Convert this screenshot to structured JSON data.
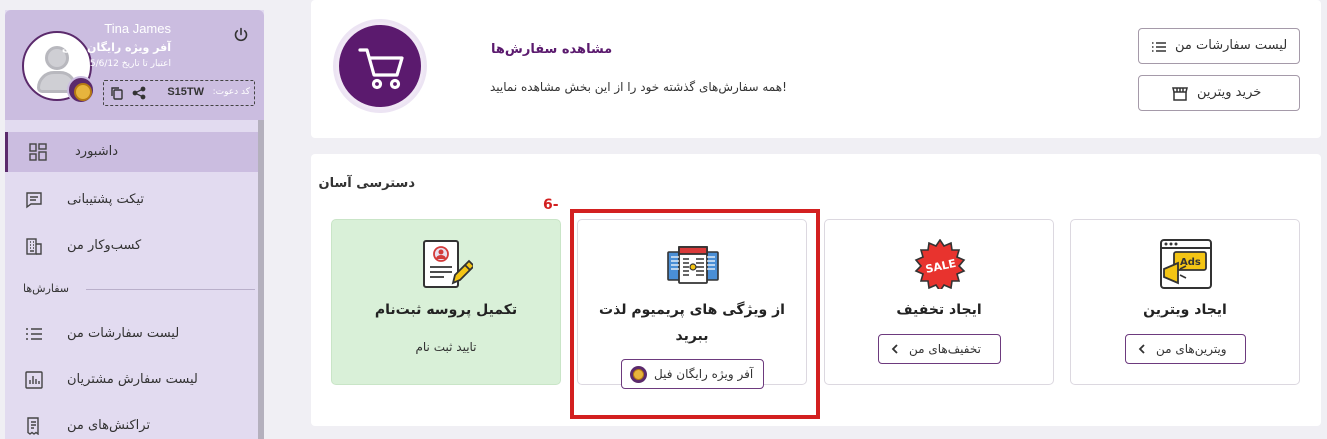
{
  "profile": {
    "name": "Tina James",
    "plan": "آفر ویژه رایگان فیل",
    "expiry": "اعتبار تا تاریخ 2025/6/12",
    "invite_label": ":کد دعوت",
    "invite_code": "S15TW"
  },
  "sidebar": {
    "items": [
      {
        "label": "داشبورد",
        "icon": "dashboard-icon",
        "active": true
      },
      {
        "label": "تیکت پشتیبانی",
        "icon": "ticket-icon"
      },
      {
        "label": "کسب‌وکار من",
        "icon": "business-icon"
      }
    ],
    "section_label": "سفارش‌ها",
    "section_items": [
      {
        "label": "لیست سفارشات من",
        "icon": "list-icon"
      },
      {
        "label": "لیست سفارش مشتریان",
        "icon": "chart-icon"
      },
      {
        "label": "تراکنش‌های من",
        "icon": "receipt-icon"
      }
    ]
  },
  "orders_card": {
    "title": "مشاهده سفارش‌ها",
    "subtitle": "همه سفارش‌های گذشته خود را از این بخش مشاهده نمایید!",
    "btn_list": "لیست سفارشات من",
    "btn_buy": "خرید ویترین"
  },
  "easy_access": {
    "title": "دسترسی آسان",
    "step_label": "6-",
    "tiles": [
      {
        "title": "ایجاد ویترین",
        "button": "ویترین‌های من",
        "icon": "ads-icon"
      },
      {
        "title": "ایجاد تخفیف",
        "button": "تخفیف‌های من",
        "icon": "sale-icon"
      },
      {
        "title_line1": "از ویژگی های پریمیوم لذت",
        "title_line2": "ببرید",
        "button": "آفر ویژه رایگان فیل",
        "icon": "premium-features-icon"
      },
      {
        "title": "تکمیل پروسه ثبت‌نام",
        "link": "تایید ثبت نام",
        "icon": "registration-form-icon"
      }
    ]
  },
  "colors": {
    "brand": "#5b1a6e",
    "sidebar_bg": "#e2dbf0",
    "profile_bg": "#cbbde0",
    "highlight": "#d32020",
    "green_tile": "#d9f0d8"
  }
}
